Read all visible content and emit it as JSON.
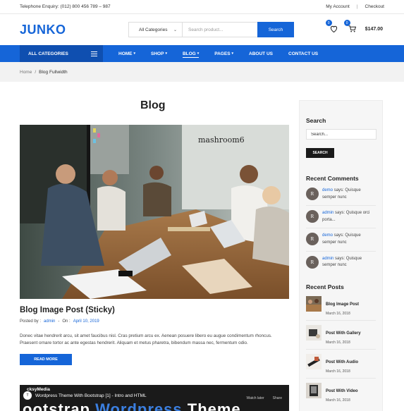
{
  "topbar": {
    "phone": "Telephone Enquiry: (012) 800 456 789 – 987",
    "my_account": "My Account",
    "separator": "|",
    "checkout": "Checkout"
  },
  "header": {
    "logo": "JUNKO",
    "category_select": "All Categories",
    "search_placeholder": "Search product...",
    "search_button": "Search",
    "wishlist_count": "0",
    "cart_count": "0",
    "cart_total": "$147.00",
    "brand_color": "#1565d8"
  },
  "nav": {
    "all_categories": "ALL CATEGORIES",
    "items": [
      {
        "label": "HOME",
        "dropdown": true
      },
      {
        "label": "SHOP",
        "dropdown": true
      },
      {
        "label": "BLOG",
        "dropdown": true
      },
      {
        "label": "PAGES",
        "dropdown": true
      },
      {
        "label": "ABOUT US",
        "dropdown": false
      },
      {
        "label": "CONTACT US",
        "dropdown": false
      }
    ],
    "active": "BLOG"
  },
  "breadcrumb": {
    "home": "Home",
    "sep": "/",
    "current": "Blog Fullwidth"
  },
  "main": {
    "title": "Blog",
    "image_sign": "mashroom6",
    "post": {
      "title": "Blog Image Post (Sticky)",
      "posted_by_label": "Posted by :",
      "author": "admin",
      "meta_sep": "-",
      "on_label": "On :",
      "date": "April 10, 2019",
      "excerpt": "Donec vitae hendrerit arcu, sit amet faucibus nisl. Cras pretium arcu ex. Aenean posuere libero eu augue condimentum rhoncus. Praesent ornare tortor ac ante egestas hendrerit. Aliquam et metus pharetra, bibendum massa nec, fermentum odio.",
      "read_more": "READ MORE"
    },
    "video": {
      "channel": "cksyMedia",
      "title": "Wordpress Theme With Bootstrap [1] - Intro and HTML",
      "watch_later": "Watch later",
      "share": "Share",
      "big_text_1": "ootstrap ",
      "big_text_2": "Wordpress",
      "big_text_3": " Theme"
    }
  },
  "sidebar": {
    "search_heading": "Search",
    "search_placeholder": "Search...",
    "search_button": "SEARCH",
    "comments_heading": "Recent Comments",
    "comments": [
      {
        "author": "demo",
        "says": "says:",
        "text": "Quisque semper nunc"
      },
      {
        "author": "admin",
        "says": "says:",
        "text": "Quisque orci porta..."
      },
      {
        "author": "demo",
        "says": "says:",
        "text": "Quisque semper nunc"
      },
      {
        "author": "admin",
        "says": "says:",
        "text": "Quisque semper nunc"
      }
    ],
    "posts_heading": "Recent Posts",
    "posts": [
      {
        "title": "Blog Image Post",
        "date": "March 16, 2018"
      },
      {
        "title": "Post With Gallery",
        "date": "March 16, 2018"
      },
      {
        "title": "Post With Audio",
        "date": "March 16, 2018"
      },
      {
        "title": "Post With Video",
        "date": "March 16, 2018"
      }
    ]
  }
}
